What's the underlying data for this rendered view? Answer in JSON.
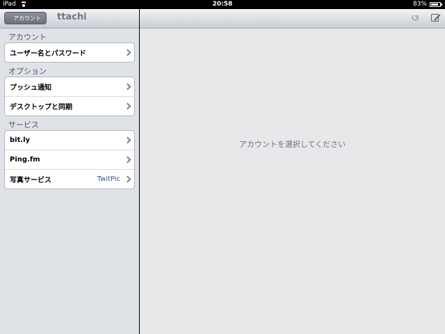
{
  "status_bar": {
    "device": "iPad",
    "time": "20:58",
    "battery": "83%"
  },
  "sidebar": {
    "back_button": "アカウント",
    "title": "ttachi",
    "sections": [
      {
        "header": "アカウント",
        "rows": [
          {
            "label": "ユーザー名とパスワード"
          }
        ]
      },
      {
        "header": "オプション",
        "rows": [
          {
            "label": "プッシュ通知"
          },
          {
            "label": "デスクトップと同期"
          }
        ]
      },
      {
        "header": "サービス",
        "rows": [
          {
            "label": "bit.ly"
          },
          {
            "label": "Ping.fm"
          },
          {
            "label": "写真サービス",
            "value": "TwitPic"
          }
        ]
      }
    ]
  },
  "detail": {
    "placeholder": "アカウントを選択してください"
  }
}
